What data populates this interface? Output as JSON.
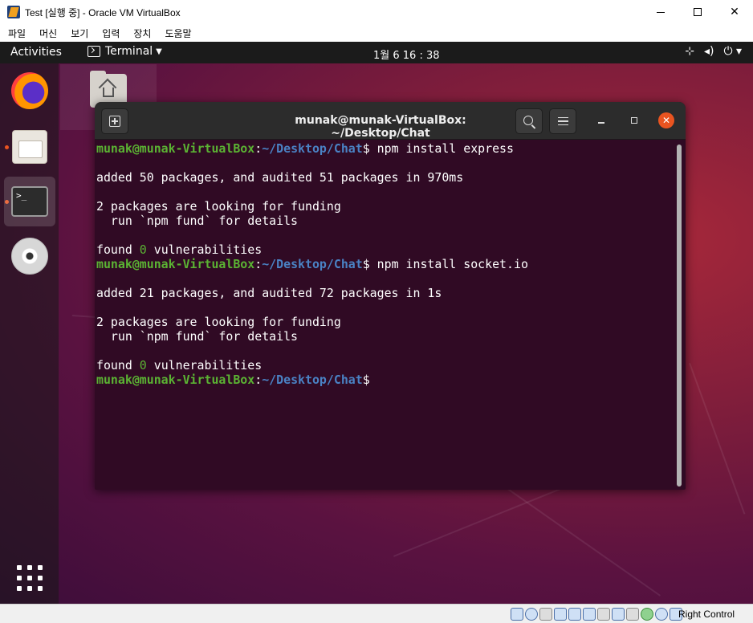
{
  "vbox": {
    "title": "Test [실행 중] - Oracle VM VirtualBox",
    "menu": [
      "파일",
      "머신",
      "보기",
      "입력",
      "장치",
      "도움말"
    ],
    "host_key": "Right Control"
  },
  "guest": {
    "topbar": {
      "activities": "Activities",
      "app_name": "Terminal",
      "clock": "1월 6  16 : 38"
    },
    "dock": {
      "terminal_glyph": ">_"
    }
  },
  "terminal": {
    "title": "munak@munak-VirtualBox: ~/Desktop/Chat",
    "prompt": {
      "user": "munak@munak-VirtualBox",
      "sep": ":",
      "path": "~/Desktop/Chat",
      "symbol": "$"
    },
    "lines": [
      {
        "type": "prompt",
        "cmd": " npm install express"
      },
      {
        "type": "text",
        "text": ""
      },
      {
        "type": "text",
        "text": "added 50 packages, and audited 51 packages in 970ms"
      },
      {
        "type": "text",
        "text": ""
      },
      {
        "type": "text",
        "text": "2 packages are looking for funding"
      },
      {
        "type": "text",
        "text": "  run `npm fund` for details"
      },
      {
        "type": "text",
        "text": ""
      },
      {
        "type": "found",
        "pre": "found ",
        "num": "0",
        "post": " vulnerabilities"
      },
      {
        "type": "prompt",
        "cmd": " npm install socket.io"
      },
      {
        "type": "text",
        "text": ""
      },
      {
        "type": "text",
        "text": "added 21 packages, and audited 72 packages in 1s"
      },
      {
        "type": "text",
        "text": ""
      },
      {
        "type": "text",
        "text": "2 packages are looking for funding"
      },
      {
        "type": "text",
        "text": "  run `npm fund` for details"
      },
      {
        "type": "text",
        "text": ""
      },
      {
        "type": "found",
        "pre": "found ",
        "num": "0",
        "post": " vulnerabilities"
      },
      {
        "type": "prompt",
        "cmd": ""
      }
    ]
  },
  "colors": {
    "terminal_bg": "#300a24",
    "prompt_user": "#5bb333",
    "prompt_path": "#4a82c4",
    "close_button": "#e95420"
  }
}
